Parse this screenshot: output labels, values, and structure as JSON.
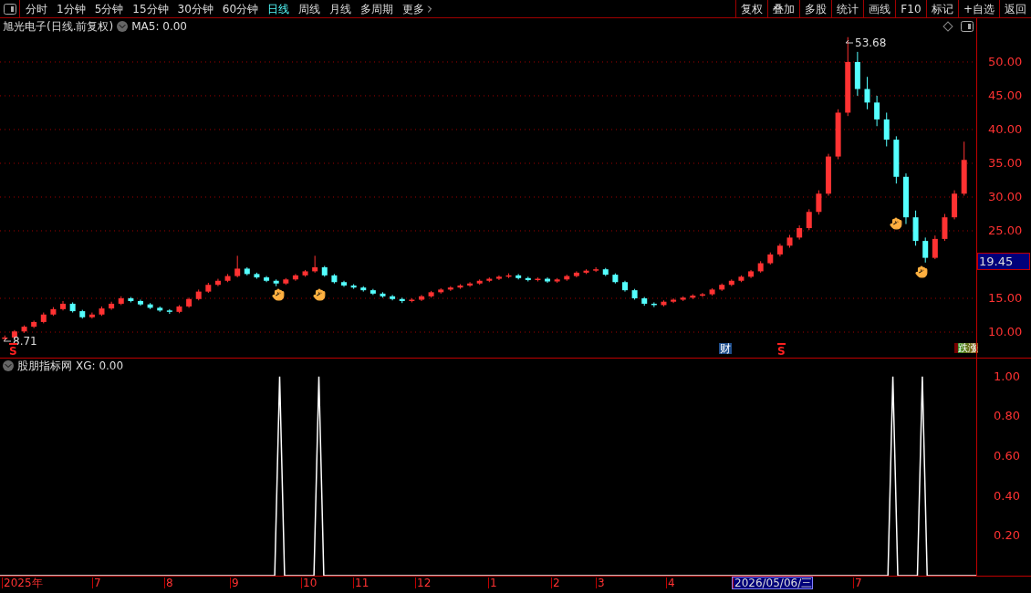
{
  "toolbar": {
    "periods": [
      {
        "label": "分时",
        "selected": false
      },
      {
        "label": "1分钟",
        "selected": false
      },
      {
        "label": "5分钟",
        "selected": false
      },
      {
        "label": "15分钟",
        "selected": false
      },
      {
        "label": "30分钟",
        "selected": false
      },
      {
        "label": "60分钟",
        "selected": false
      },
      {
        "label": "日线",
        "selected": true
      },
      {
        "label": "周线",
        "selected": false
      },
      {
        "label": "月线",
        "selected": false
      },
      {
        "label": "多周期",
        "selected": false
      },
      {
        "label": "更多",
        "selected": false
      }
    ],
    "actions": [
      "复权",
      "叠加",
      "多股",
      "统计",
      "画线",
      "F10",
      "标记",
      "+自选",
      "返回"
    ]
  },
  "main_chart": {
    "title": "旭光电子(日线.前复权)",
    "indicator": "MA5: 0.00",
    "current_price": "19.45",
    "high_label": "53.68",
    "low_label": "8.71",
    "markers": [
      {
        "kind": "signal",
        "text": "S"
      },
      {
        "kind": "finance",
        "text": "财"
      },
      {
        "kind": "signal",
        "text": "S"
      },
      {
        "kind": "limit",
        "text": "跌涨"
      }
    ],
    "chart_data": {
      "type": "candlestick",
      "ylim": [
        6.22,
        56.48
      ],
      "grid": true,
      "yticks": [
        {
          "value": 50,
          "label": "50.00"
        },
        {
          "value": 45,
          "label": "45.00"
        },
        {
          "value": 40,
          "label": "40.00"
        },
        {
          "value": 35,
          "label": "35.00"
        },
        {
          "value": 30,
          "label": "30.00"
        },
        {
          "value": 25,
          "label": "25.00"
        },
        {
          "value": 15,
          "label": "15.00"
        },
        {
          "value": 10,
          "label": "10.00"
        }
      ],
      "categories": [
        null,
        null,
        null,
        null,
        null,
        null,
        null,
        null,
        null,
        null,
        null,
        null,
        null,
        null,
        null,
        null,
        null,
        null,
        null,
        null,
        null,
        null,
        null,
        null,
        null,
        null,
        null,
        null,
        null,
        null,
        null,
        null,
        null,
        null,
        null,
        null,
        null,
        null,
        null,
        null,
        null,
        null,
        null,
        null,
        null,
        null,
        null,
        null,
        null,
        null,
        null,
        null,
        null,
        null,
        null,
        null,
        null,
        null,
        null,
        null,
        null,
        null,
        null,
        null,
        null,
        null,
        null,
        null,
        null,
        null,
        null,
        null,
        null,
        null,
        null,
        null,
        null,
        null,
        null,
        null,
        null,
        null,
        null,
        null,
        null,
        null,
        null,
        null,
        null,
        null,
        null,
        null,
        null,
        null,
        null,
        null,
        null,
        null,
        null,
        null
      ],
      "ohlc": [
        [
          9.0,
          9.5,
          8.71,
          9.2
        ],
        [
          9.2,
          10.3,
          9.0,
          10.1
        ],
        [
          10.1,
          11.0,
          9.9,
          10.8
        ],
        [
          10.8,
          11.7,
          10.6,
          11.5
        ],
        [
          11.5,
          12.9,
          11.3,
          12.6
        ],
        [
          12.6,
          13.7,
          12.4,
          13.4
        ],
        [
          13.4,
          14.6,
          13.2,
          14.2
        ],
        [
          14.2,
          14.4,
          12.9,
          13.1
        ],
        [
          13.1,
          13.3,
          12.0,
          12.2
        ],
        [
          12.2,
          12.9,
          12.0,
          12.6
        ],
        [
          12.6,
          13.8,
          12.4,
          13.5
        ],
        [
          13.5,
          14.5,
          13.3,
          14.2
        ],
        [
          14.2,
          15.3,
          14.0,
          15.0
        ],
        [
          15.0,
          15.2,
          14.4,
          14.6
        ],
        [
          14.6,
          14.8,
          13.9,
          14.1
        ],
        [
          14.1,
          14.3,
          13.4,
          13.6
        ],
        [
          13.6,
          13.8,
          13.0,
          13.2
        ],
        [
          13.2,
          13.4,
          12.7,
          13.0
        ],
        [
          13.0,
          14.0,
          12.8,
          13.8
        ],
        [
          13.8,
          15.1,
          13.6,
          14.9
        ],
        [
          14.9,
          16.3,
          14.7,
          16.0
        ],
        [
          16.0,
          17.3,
          15.8,
          17.0
        ],
        [
          17.0,
          17.9,
          16.8,
          17.6
        ],
        [
          17.6,
          18.6,
          17.4,
          18.3
        ],
        [
          18.3,
          21.3,
          18.1,
          19.4
        ],
        [
          19.4,
          19.6,
          18.4,
          18.6
        ],
        [
          18.6,
          18.8,
          17.9,
          18.1
        ],
        [
          18.1,
          18.3,
          17.4,
          17.6
        ],
        [
          17.6,
          17.8,
          16.8,
          17.2
        ],
        [
          17.2,
          18.0,
          17.0,
          17.8
        ],
        [
          17.8,
          18.6,
          17.6,
          18.4
        ],
        [
          18.4,
          19.2,
          18.2,
          19.0
        ],
        [
          19.0,
          21.3,
          18.8,
          19.6
        ],
        [
          19.6,
          19.8,
          18.2,
          18.4
        ],
        [
          18.4,
          18.6,
          17.2,
          17.4
        ],
        [
          17.4,
          17.6,
          16.7,
          16.9
        ],
        [
          16.9,
          17.1,
          16.4,
          16.6
        ],
        [
          16.6,
          16.8,
          16.0,
          16.2
        ],
        [
          16.2,
          16.4,
          15.5,
          15.7
        ],
        [
          15.7,
          15.9,
          15.1,
          15.3
        ],
        [
          15.3,
          15.5,
          14.7,
          14.9
        ],
        [
          14.9,
          15.1,
          14.3,
          14.6
        ],
        [
          14.6,
          15.0,
          14.4,
          14.8
        ],
        [
          14.8,
          15.5,
          14.6,
          15.3
        ],
        [
          15.3,
          16.1,
          15.1,
          15.9
        ],
        [
          15.9,
          16.5,
          15.7,
          16.3
        ],
        [
          16.3,
          16.8,
          16.1,
          16.6
        ],
        [
          16.6,
          17.1,
          16.4,
          16.9
        ],
        [
          16.9,
          17.4,
          16.7,
          17.2
        ],
        [
          17.2,
          17.8,
          17.0,
          17.6
        ],
        [
          17.6,
          18.1,
          17.4,
          17.9
        ],
        [
          17.9,
          18.4,
          17.7,
          18.2
        ],
        [
          18.2,
          18.7,
          18.0,
          18.4
        ],
        [
          18.4,
          18.6,
          17.8,
          18.0
        ],
        [
          18.0,
          18.2,
          17.5,
          17.7
        ],
        [
          17.7,
          18.1,
          17.5,
          17.9
        ],
        [
          17.9,
          18.1,
          17.3,
          17.5
        ],
        [
          17.5,
          18.0,
          17.3,
          17.8
        ],
        [
          17.8,
          18.5,
          17.6,
          18.3
        ],
        [
          18.3,
          19.0,
          18.1,
          18.8
        ],
        [
          18.8,
          19.3,
          18.6,
          19.1
        ],
        [
          19.1,
          19.6,
          18.9,
          19.3
        ],
        [
          19.3,
          19.5,
          18.3,
          18.5
        ],
        [
          18.5,
          18.7,
          17.2,
          17.4
        ],
        [
          17.4,
          17.6,
          16.0,
          16.2
        ],
        [
          16.2,
          16.4,
          14.8,
          15.0
        ],
        [
          15.0,
          15.2,
          13.9,
          14.2
        ],
        [
          14.2,
          14.4,
          13.7,
          14.0
        ],
        [
          14.0,
          14.7,
          13.8,
          14.5
        ],
        [
          14.5,
          15.0,
          14.3,
          14.8
        ],
        [
          14.8,
          15.3,
          14.6,
          15.1
        ],
        [
          15.1,
          15.6,
          14.9,
          15.4
        ],
        [
          15.4,
          15.8,
          15.2,
          15.6
        ],
        [
          15.6,
          16.5,
          15.4,
          16.3
        ],
        [
          16.3,
          17.2,
          16.1,
          17.0
        ],
        [
          17.0,
          17.8,
          16.8,
          17.6
        ],
        [
          17.6,
          18.4,
          17.4,
          18.2
        ],
        [
          18.2,
          19.2,
          18.0,
          19.0
        ],
        [
          19.0,
          20.5,
          18.8,
          20.2
        ],
        [
          20.2,
          21.8,
          20.0,
          21.5
        ],
        [
          21.5,
          23.1,
          21.2,
          22.8
        ],
        [
          22.8,
          24.4,
          22.5,
          24.0
        ],
        [
          24.0,
          25.8,
          23.7,
          25.4
        ],
        [
          25.4,
          28.2,
          25.1,
          27.8
        ],
        [
          27.8,
          31.0,
          27.4,
          30.5
        ],
        [
          30.5,
          36.4,
          30.2,
          36.0
        ],
        [
          36.0,
          43.0,
          35.6,
          42.5
        ],
        [
          42.5,
          53.68,
          42.0,
          50.0
        ],
        [
          50.0,
          51.5,
          45.0,
          46.0
        ],
        [
          46.0,
          47.8,
          43.0,
          44.0
        ],
        [
          44.0,
          45.0,
          40.5,
          41.5
        ],
        [
          41.5,
          42.5,
          37.5,
          38.5
        ],
        [
          38.5,
          39.0,
          32.0,
          33.0
        ],
        [
          33.0,
          33.5,
          26.0,
          27.0
        ],
        [
          27.0,
          28.0,
          22.8,
          23.5
        ],
        [
          23.5,
          24.0,
          20.3,
          21.0
        ],
        [
          21.0,
          24.3,
          20.8,
          23.8
        ],
        [
          23.8,
          27.5,
          23.5,
          27.0
        ],
        [
          27.0,
          31.0,
          26.7,
          30.5
        ],
        [
          30.5,
          38.2,
          30.2,
          35.5
        ]
      ]
    }
  },
  "indicator_panel": {
    "title": "股朋指标网",
    "reading": ": 0.00",
    "chart_data": {
      "type": "line",
      "ylim": [
        0,
        1.09
      ],
      "yticks": [
        {
          "value": 1,
          "label": "1.00"
        },
        {
          "value": 0.8,
          "label": "0.80"
        },
        {
          "value": 0.6,
          "label": "0.60"
        },
        {
          "value": 0.4,
          "label": "0.40"
        },
        {
          "value": 0.2,
          "label": "0.20"
        }
      ],
      "categories": [
        null,
        null,
        null,
        null,
        null,
        null,
        null,
        null,
        null,
        null,
        null,
        null,
        null,
        null,
        null,
        null,
        null,
        null,
        null,
        null,
        null,
        null,
        null,
        null,
        null,
        null,
        null,
        null,
        null,
        null,
        null,
        null,
        null,
        null,
        null,
        null,
        null,
        null,
        null,
        null,
        null,
        null,
        null,
        null,
        null,
        null,
        null,
        null,
        null,
        null,
        null,
        null,
        null,
        null,
        null,
        null,
        null,
        null,
        null,
        null,
        null,
        null,
        null,
        null,
        null,
        null,
        null,
        null,
        null,
        null,
        null,
        null,
        null,
        null,
        null,
        null,
        null,
        null,
        null,
        null,
        null,
        null,
        null,
        null,
        null,
        null,
        null,
        null,
        null,
        null,
        null,
        null,
        null,
        null,
        null,
        null,
        null,
        null,
        null,
        null,
        null,
        null,
        null,
        null,
        null,
        null,
        null,
        null,
        null,
        null,
        null,
        null,
        null,
        null,
        null,
        null,
        null,
        null,
        null,
        null,
        null,
        null,
        null,
        null,
        null,
        null,
        null,
        null,
        null,
        null,
        null,
        null,
        null,
        null,
        null,
        null,
        null,
        null,
        null,
        null,
        null,
        null,
        null,
        null,
        null,
        null,
        null,
        null,
        null,
        null,
        null,
        null,
        null,
        null,
        null,
        null,
        null,
        null,
        null,
        null,
        null,
        null,
        null,
        null,
        null,
        null,
        null,
        null,
        null,
        null,
        null,
        null,
        null,
        null,
        null,
        null,
        null,
        null,
        null,
        null,
        null,
        null,
        null,
        null,
        null,
        null,
        null,
        null,
        null,
        null,
        null,
        null,
        null,
        null,
        null,
        null,
        null,
        null,
        null,
        null
      ],
      "series": [
        {
          "name": "XG",
          "color": "#ffffff",
          "values": [
            0,
            0,
            0,
            0,
            0,
            0,
            0,
            0,
            0,
            0,
            0,
            0,
            0,
            0,
            0,
            0,
            0,
            0,
            0,
            0,
            0,
            0,
            0,
            0,
            0,
            0,
            0,
            0,
            0,
            0,
            0,
            0,
            0,
            0,
            0,
            0,
            0,
            0,
            0,
            0,
            0,
            0,
            0,
            0,
            0,
            0,
            0,
            0,
            0,
            0,
            0,
            0,
            0,
            0,
            0,
            0,
            0,
            1,
            0,
            0,
            0,
            0,
            0,
            0,
            0,
            1,
            0,
            0,
            0,
            0,
            0,
            0,
            0,
            0,
            0,
            0,
            0,
            0,
            0,
            0,
            0,
            0,
            0,
            0,
            0,
            0,
            0,
            0,
            0,
            0,
            0,
            0,
            0,
            0,
            0,
            0,
            0,
            0,
            0,
            0,
            0,
            0,
            0,
            0,
            0,
            0,
            0,
            0,
            0,
            0,
            0,
            0,
            0,
            0,
            0,
            0,
            0,
            0,
            0,
            0,
            0,
            0,
            0,
            0,
            0,
            0,
            0,
            0,
            0,
            0,
            0,
            0,
            0,
            0,
            0,
            0,
            0,
            0,
            0,
            0,
            0,
            0,
            0,
            0,
            0,
            0,
            0,
            0,
            0,
            0,
            0,
            0,
            0,
            0,
            0,
            0,
            0,
            0,
            0,
            0,
            0,
            0,
            0,
            0,
            0,
            0,
            0,
            0,
            0,
            0,
            0,
            0,
            0,
            0,
            0,
            0,
            0,
            0,
            0,
            0,
            0,
            0,
            1,
            0,
            0,
            0,
            0,
            0,
            1,
            0,
            0,
            0,
            0,
            0,
            0,
            0,
            0,
            0,
            0,
            0
          ]
        }
      ]
    }
  },
  "date_axis": [
    {
      "label": "2025年",
      "selected": false
    },
    {
      "label": "7",
      "selected": false
    },
    {
      "label": "8",
      "selected": false
    },
    {
      "label": "9",
      "selected": false
    },
    {
      "label": "10",
      "selected": false
    },
    {
      "label": "11",
      "selected": false
    },
    {
      "label": "12",
      "selected": false
    },
    {
      "label": "1",
      "selected": false
    },
    {
      "label": "2",
      "selected": false
    },
    {
      "label": "3",
      "selected": false
    },
    {
      "label": "4",
      "selected": false
    },
    {
      "label": "2026/05/06/三",
      "selected": true
    },
    {
      "label": "7",
      "selected": false
    }
  ]
}
